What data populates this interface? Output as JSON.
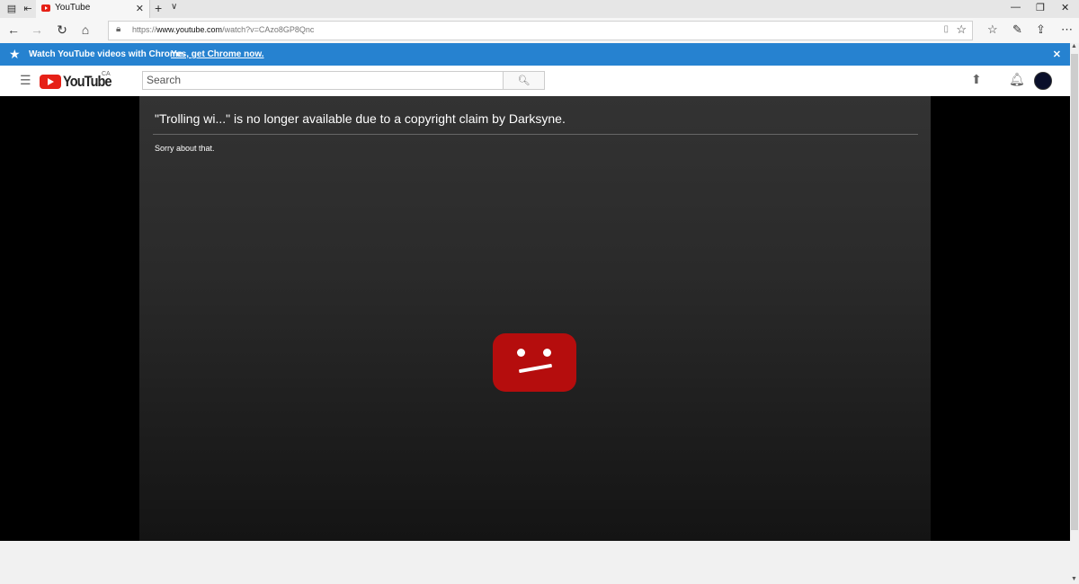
{
  "browser": {
    "tab_title": "YouTube",
    "url_prefix": "https://",
    "url_host": "www.youtube.com",
    "url_path": "/watch?v=CAzo8GP8Qnc",
    "icons": [
      "tab-preview-icon",
      "set-aside-icon",
      "back-icon",
      "forward-icon",
      "refresh-icon",
      "home-icon",
      "lock-icon",
      "reading-view-icon",
      "favorite-star-icon",
      "favorites-hub-icon",
      "notes-icon",
      "share-icon",
      "more-icon",
      "minimize-icon",
      "restore-icon",
      "close-icon"
    ]
  },
  "banner": {
    "text": "Watch YouTube videos with Chrome.",
    "link": "Yes, get Chrome now.",
    "color": "#2682d0"
  },
  "youtube": {
    "logo_text": "YouTube",
    "country": "CA",
    "search_placeholder": "Search",
    "brand_color": "#e62117"
  },
  "player": {
    "error_title": "\"Trolling wi...\" is no longer available due to a copyright claim by Darksyne.",
    "error_subtitle": "Sorry about that."
  }
}
